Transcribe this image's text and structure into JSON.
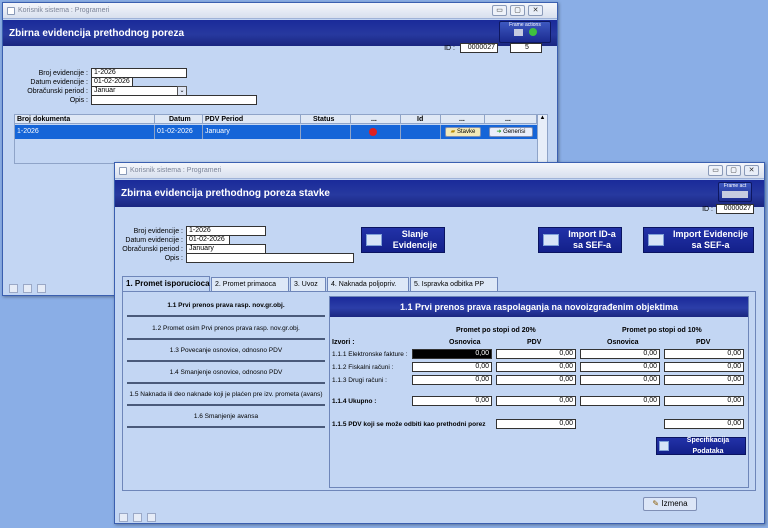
{
  "back_window": {
    "titlebar": "Korisnik sistema : Programeri",
    "header_title": "Zbirna evidencija prethodnog poreza",
    "frame_actions": "Frame actions",
    "id_label": "ID :",
    "id_value": "0000027",
    "count_value": "5",
    "fields": {
      "broj_label": "Broj evidencije :",
      "broj_value": "1-2026",
      "datum_label": "Datum evidencije :",
      "datum_value": "01-02-2026",
      "period_label": "Obračunski period :",
      "period_value": "Januar",
      "opis_label": "Opis :",
      "opis_value": ""
    },
    "table": {
      "headers": [
        "Broj dokumenta",
        "Datum",
        "PDV Period",
        "Status",
        "...",
        "Id",
        "...",
        "..."
      ],
      "row": {
        "broj": "1-2026",
        "datum": "01-02-2026",
        "period": "January",
        "stavke": "Stavke",
        "generisi": "Generisi"
      }
    }
  },
  "front_window": {
    "titlebar": "Korisnik sistema : Programeri",
    "header_title": "Zbirna evidencija prethodnog poreza stavke",
    "frame_actions": "Frame act",
    "id_label": "ID :",
    "id_value": "0000027",
    "fields": {
      "broj_label": "Broj evidencije :",
      "broj_value": "1-2026",
      "datum_label": "Datum evidencije :",
      "datum_value": "01-02-2026",
      "period_label": "Obračunski period :",
      "period_value": "January",
      "opis_label": "Opis :",
      "opis_value": ""
    },
    "buttons": {
      "slanje": "Slanje Evidencije",
      "import_id": "Import ID-a sa SEF-a",
      "import_ev": "Import Evidencije sa SEF-a"
    },
    "tabs": [
      "1. Promet isporucioca",
      "2. Promet primaoca",
      "3. Uvoz",
      "4. Naknada poljopriv.",
      "5. Ispravka odbitka PP"
    ],
    "nav": [
      "1.1 Prvi prenos prava rasp. nov.gr.obj.",
      "1.2 Promet osim Prvi prenos prava rasp. nov.gr.obj.",
      "1.3 Povecanje osnovice, odnosno PDV",
      "1.4 Smanjenje osnovice, odnosno PDV",
      "1.5 Naknada ili deo naknade koji je plaćen pre izv. prometa (avans)",
      "1.6 Smanjenje avansa"
    ],
    "panel": {
      "title": "1.1 Prvi prenos prava raspolaganja na novoizgrađenim objektima",
      "group20": "Promet po stopi od 20%",
      "group10": "Promet po stopi od 10%",
      "izvori": "Izvori :",
      "col_osnovica": "Osnovica",
      "col_pdv": "PDV",
      "rows": [
        {
          "label": "1.1.1 Elektronske fakture :",
          "v": [
            "0,00",
            "0,00",
            "0,00",
            "0,00"
          ]
        },
        {
          "label": "1.1.2 Fiskalni računi :",
          "v": [
            "0,00",
            "0,00",
            "0,00",
            "0,00"
          ]
        },
        {
          "label": "1.1.3 Drugi računi :",
          "v": [
            "0,00",
            "0,00",
            "0,00",
            "0,00"
          ]
        }
      ],
      "ukupno_label": "1.1.4 Ukupno :",
      "ukupno": [
        "0,00",
        "0,00",
        "0,00",
        "0,00"
      ],
      "pdv_ne_label": "1.1.5 PDV koji se može odbiti kao prethodni porez",
      "pdv_ne": [
        "0,00",
        "0,00"
      ],
      "spec_btn": "Specifikacija Podataka"
    },
    "izmena_btn": "Izmena"
  }
}
